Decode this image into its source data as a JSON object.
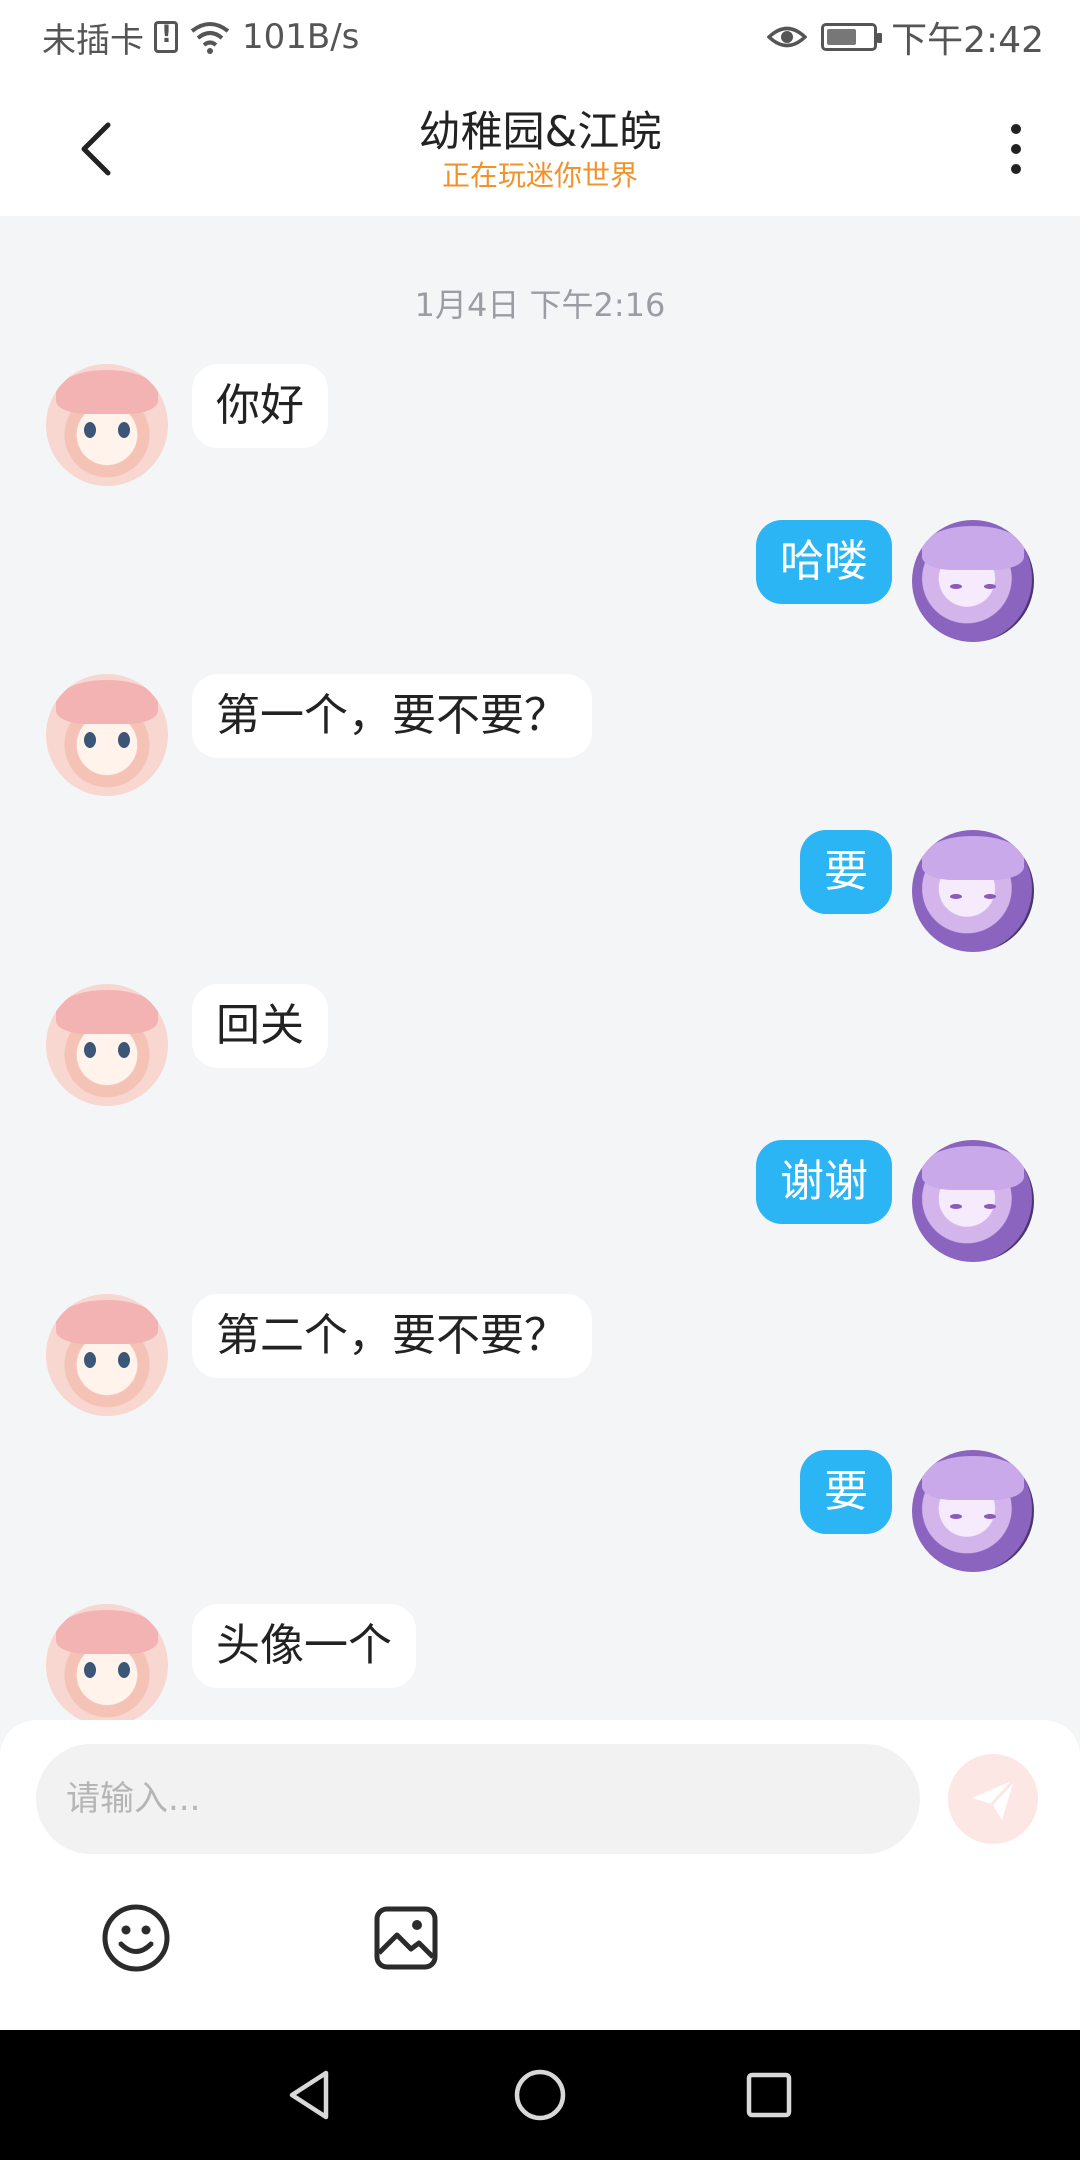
{
  "status_bar": {
    "carrier": "未插卡",
    "speed": "101B/s",
    "time": "下午2:42",
    "battery_level": 0.65
  },
  "header": {
    "title": "幼稚园&江皖",
    "subtitle": "正在玩迷你世界"
  },
  "chat": {
    "timestamp": "1月4日 下午2:16",
    "messages": [
      {
        "side": "left",
        "text": "你好"
      },
      {
        "side": "right",
        "text": "哈喽"
      },
      {
        "side": "left",
        "text": "第一个，要不要？"
      },
      {
        "side": "right",
        "text": "要"
      },
      {
        "side": "left",
        "text": "回关"
      },
      {
        "side": "right",
        "text": "谢谢"
      },
      {
        "side": "left",
        "text": "第二个，要不要？"
      },
      {
        "side": "right",
        "text": "要"
      },
      {
        "side": "left",
        "text": "头像一个"
      }
    ]
  },
  "input": {
    "placeholder": "请输入...",
    "value": ""
  },
  "icons": {
    "back": "back-arrow-icon",
    "more": "more-vertical-icon",
    "send": "send-icon",
    "emoji": "emoji-icon",
    "image": "image-icon"
  },
  "colors": {
    "accent_orange": "#f2922b",
    "bubble_blue": "#2cb5f5",
    "send_disabled": "#fde7e5"
  }
}
